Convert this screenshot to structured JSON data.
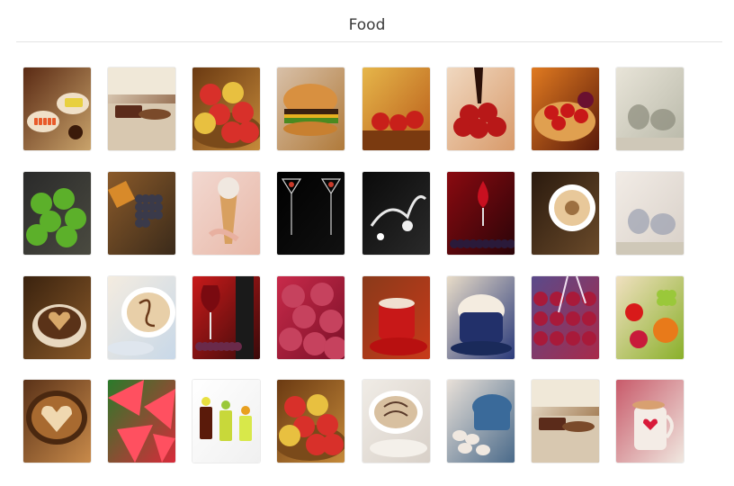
{
  "header": {
    "title": "Food"
  },
  "gallery": {
    "rows": [
      [
        {
          "name": "sushi-platter",
          "bg": [
            "#5a2a14",
            "#c9a36b"
          ],
          "accent": "#e85a2a",
          "motif": "plates"
        },
        {
          "name": "bread-dessert-table",
          "bg": [
            "#e8dcc8",
            "#7a4a2a"
          ],
          "accent": "#5b2b1a",
          "motif": "table"
        },
        {
          "name": "apple-basket",
          "bg": [
            "#6b3a12",
            "#c58a3a"
          ],
          "accent": "#d8302a",
          "motif": "apples"
        },
        {
          "name": "burger",
          "bg": [
            "#d8c0a8",
            "#b07a3a"
          ],
          "accent": "#d09040",
          "motif": "burger"
        },
        {
          "name": "autumn-apples",
          "bg": [
            "#e6b64a",
            "#b85a18"
          ],
          "accent": "#c8201a",
          "motif": "apples-light"
        },
        {
          "name": "chocolate-strawberries",
          "bg": [
            "#f0d8c0",
            "#d89a6a"
          ],
          "accent": "#b81818",
          "motif": "strawberries"
        },
        {
          "name": "fruit-tart",
          "bg": [
            "#e07a20",
            "#5a1a0a"
          ],
          "accent": "#c81818",
          "motif": "tart"
        },
        {
          "name": "tea-set-light",
          "bg": [
            "#e8e4d8",
            "#b8b8a8"
          ],
          "accent": "#8a8a7a",
          "motif": "teaset"
        }
      ],
      [
        {
          "name": "green-apples",
          "bg": [
            "#2a2a2a",
            "#4a4a40"
          ],
          "accent": "#5cb02a",
          "motif": "green-apples"
        },
        {
          "name": "grapes-autumn",
          "bg": [
            "#8a5a2a",
            "#3a2a1a"
          ],
          "accent": "#3a3a4a",
          "motif": "grapes"
        },
        {
          "name": "ice-cream-cone",
          "bg": [
            "#f2d8d0",
            "#e8b8a8"
          ],
          "accent": "#d88a6a",
          "motif": "cone"
        },
        {
          "name": "martini-glasses",
          "bg": [
            "#000000",
            "#111111"
          ],
          "accent": "#c83a2a",
          "motif": "glasses-dark"
        },
        {
          "name": "smoke-splash",
          "bg": [
            "#0a0a0a",
            "#2a2a2a"
          ],
          "accent": "#e8e8e8",
          "motif": "splash"
        },
        {
          "name": "red-wine-berries",
          "bg": [
            "#8a0a10",
            "#2a0408"
          ],
          "accent": "#6a0a1a",
          "motif": "wine"
        },
        {
          "name": "coffee-beans-cup",
          "bg": [
            "#2a1a0e",
            "#6a4a2a"
          ],
          "accent": "#e8c89a",
          "motif": "coffee-top"
        },
        {
          "name": "tea-set-white",
          "bg": [
            "#f2ece6",
            "#d8d0c8"
          ],
          "accent": "#9aa0b0",
          "motif": "teaset"
        }
      ],
      [
        {
          "name": "heart-coffee-beans",
          "bg": [
            "#3a220e",
            "#8a5a2a"
          ],
          "accent": "#d8a86a",
          "motif": "coffee-heart"
        },
        {
          "name": "latte-art-love",
          "bg": [
            "#f4ece0",
            "#c8d8e8"
          ],
          "accent": "#6a3a1a",
          "motif": "latte-cup"
        },
        {
          "name": "wine-bottle-grapes",
          "bg": [
            "#c81a1a",
            "#3a0a0a"
          ],
          "accent": "#6a2a4a",
          "motif": "wine-bottle"
        },
        {
          "name": "frozen-raspberries",
          "bg": [
            "#c82a4a",
            "#7a1028"
          ],
          "accent": "#f0c0d0",
          "motif": "raspberries"
        },
        {
          "name": "hot-chocolate-marshmallow",
          "bg": [
            "#8a3a1a",
            "#c83a1a"
          ],
          "accent": "#f0e0d0",
          "motif": "mug-red"
        },
        {
          "name": "cappuccino-blue-cup",
          "bg": [
            "#e8dcc8",
            "#2a3a7a"
          ],
          "accent": "#f4ece0",
          "motif": "blue-cup"
        },
        {
          "name": "frosted-berries",
          "bg": [
            "#5a4a8a",
            "#a82a4a"
          ],
          "accent": "#f0e0f0",
          "motif": "frost-berries"
        },
        {
          "name": "mixed-fruit",
          "bg": [
            "#f0e0c0",
            "#8ab02a"
          ],
          "accent": "#e87a1a",
          "motif": "fruit-mix"
        }
      ],
      [
        {
          "name": "latte-heart",
          "bg": [
            "#5a3218",
            "#c88a4a"
          ],
          "accent": "#f0d8b0",
          "motif": "latte-heart"
        },
        {
          "name": "watermelon-slices",
          "bg": [
            "#2a7a2a",
            "#d82a3a"
          ],
          "accent": "#ff6070",
          "motif": "watermelon"
        },
        {
          "name": "cocktail-glasses",
          "bg": [
            "#ffffff",
            "#f0f0f0"
          ],
          "accent": "#a8c83a",
          "motif": "cocktails"
        },
        {
          "name": "apple-basket-2",
          "bg": [
            "#6b3a12",
            "#c58a3a"
          ],
          "accent": "#d8302a",
          "motif": "apples"
        },
        {
          "name": "coffee-cup-pattern",
          "bg": [
            "#f0ece6",
            "#d8d0c8"
          ],
          "accent": "#5a3a2a",
          "motif": "cup-saucer"
        },
        {
          "name": "macarons-cups",
          "bg": [
            "#e8e0d8",
            "#4a6a8a"
          ],
          "accent": "#3a6a9a",
          "motif": "macarons"
        },
        {
          "name": "dessert-table-2",
          "bg": [
            "#f0e8d8",
            "#8a5a2a"
          ],
          "accent": "#5b2b1a",
          "motif": "table"
        },
        {
          "name": "love-mug",
          "bg": [
            "#c85a6a",
            "#f0e8e0"
          ],
          "accent": "#d81a3a",
          "motif": "love-mug"
        }
      ]
    ]
  }
}
